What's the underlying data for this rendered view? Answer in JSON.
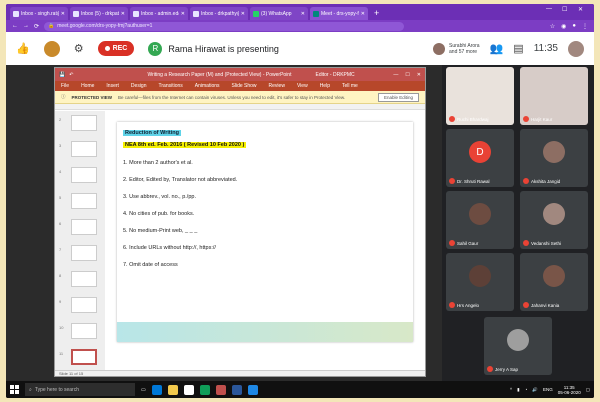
{
  "browser": {
    "tabs": [
      {
        "label": "Inbox - singh.rat@gmail.com"
      },
      {
        "label": "Inbox (5) - drkpathy@gmail.com"
      },
      {
        "label": "Inbox - admin.ed@gmail.com"
      },
      {
        "label": "Inbox - drkpathy@gmail.com"
      },
      {
        "label": "(3) WhatsApp"
      },
      {
        "label": "Meet - drs-yopy-fmj",
        "active": true
      }
    ],
    "new_tab": "+",
    "url": "meet.google.com/drs-yopy-fmj?authuser=1"
  },
  "meet": {
    "rec_label": "REC",
    "presenter_initial": "R",
    "presenter_text": "Rama Hirawat is presenting",
    "people_line1": "Surabhi Arora",
    "people_line2": "and 57 more",
    "clock": "11:35"
  },
  "ppt": {
    "title": "Writing a Research Paper (M) and (Protected View) - PowerPoint",
    "user": "Editor - DRKPMC",
    "menu": [
      "File",
      "Home",
      "Insert",
      "Design",
      "Transitions",
      "Animations",
      "Slide Show",
      "Review",
      "View",
      "Help",
      "Tell me"
    ],
    "protected_label": "PROTECTED VIEW",
    "protected_msg": "Be careful—files from the Internet can contain viruses. Unless you need to edit, it's safer to stay in Protected View.",
    "enable_button": "Enable Editing",
    "thumb_numbers": [
      "2",
      "3",
      "4",
      "5",
      "6",
      "7",
      "8",
      "9",
      "10",
      "11"
    ],
    "status": "Slide 11 of 15",
    "slide": {
      "heading1": "Reduction of Writing",
      "heading2": "NEA 8th ed. Feb. 2016 ( Revised 10 Feb 2020 )",
      "items": [
        "1.  More than 2 author's et al.",
        "2.  Editor, Edited by, Translator not abbreviated.",
        "3.  Use abbrev., vol. no., p./pp.",
        "4.  No cities of pub. for books.",
        "5.  No medium-Print web, _ _ _",
        "6.  Include URLs without http://, https://",
        "7.  Omit date of access"
      ]
    }
  },
  "participants": [
    {
      "name": "Ruchi Bhardwaj",
      "initial": "",
      "video": true
    },
    {
      "name": "Harjit Kaur",
      "initial": "",
      "video": true
    },
    {
      "name": "Dr. Shruti Rawal",
      "initial": "D",
      "color": "#e94235"
    },
    {
      "name": "Akshita Jangid",
      "initial": "",
      "color": "#8d6e63"
    },
    {
      "name": "Sahil Gaur",
      "initial": "",
      "color": "#6d4c41"
    },
    {
      "name": "Vedanshi Sethi",
      "initial": "",
      "color": "#a1887f"
    },
    {
      "name": "Hrs Angelo",
      "initial": "",
      "color": "#5d4037"
    },
    {
      "name": "Jahanvi Kania",
      "initial": "",
      "color": "#795548"
    },
    {
      "name": "Jerry A Sap",
      "initial": "",
      "color": "#9e9e9e"
    }
  ],
  "taskbar": {
    "search_placeholder": "Type here to search",
    "time": "11:35",
    "date": "05-06-2020",
    "lang": "ENG"
  }
}
